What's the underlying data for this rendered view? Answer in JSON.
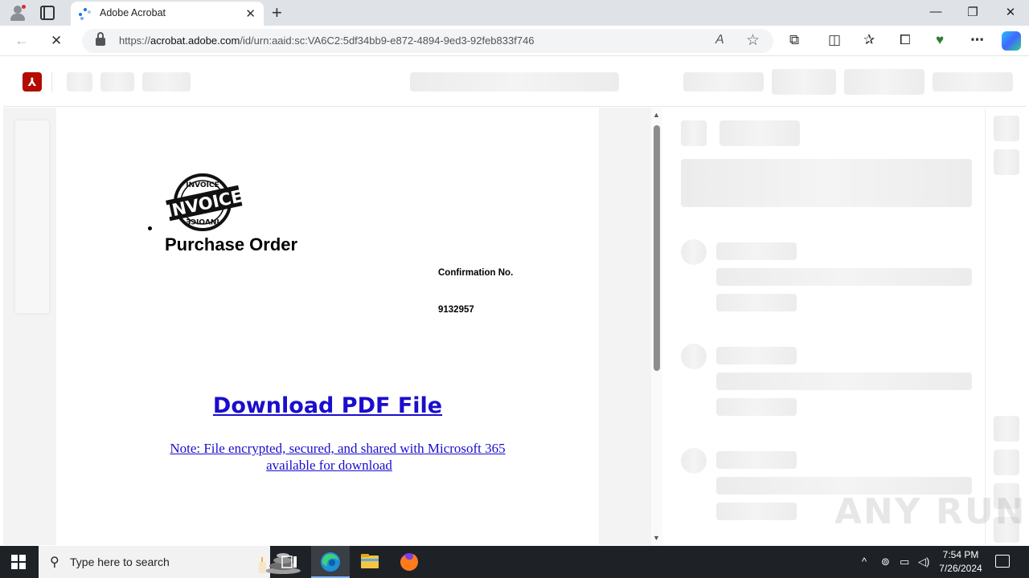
{
  "browser": {
    "tab_title": "Adobe Acrobat",
    "url_prefix": "https://",
    "url_domain": "acrobat.adobe.com",
    "url_path": "/id/urn:aaid:sc:VA6C2:5df34bb9-e872-4894-9ed3-92feb833f746",
    "new_tab_glyph": "+",
    "close_glyph": "✕",
    "minimize_glyph": "—",
    "restore_glyph": "❐",
    "window_close_glyph": "✕",
    "back_glyph": "←",
    "reload_glyph": "✕",
    "read_aloud_glyph": "A",
    "favorite_glyph": "☆",
    "extensions_glyph": "⧉",
    "split_glyph": "◫",
    "favorites_glyph": "✰",
    "collections_glyph": "⧠",
    "browser_essentials_glyph": "♥",
    "more_glyph": "⋯"
  },
  "document": {
    "stamp_text": "INVOICE",
    "title": "Purchase Order",
    "confirmation_label": "Confirmation No.",
    "confirmation_value": "9132957",
    "download_link": "Download PDF File",
    "note_line1": "Note: File encrypted, secured, and shared with Microsoft 365 ",
    "note_line2": "available for download"
  },
  "watermark": "ANY RUN",
  "taskbar": {
    "search_placeholder": "Type here to search",
    "time": "7:54 PM",
    "date": "7/26/2024",
    "tray_chevron": "^"
  },
  "colors": {
    "link": "#1a0dcc",
    "acrobat_red": "#b30b00",
    "taskbar": "#1e2126"
  }
}
